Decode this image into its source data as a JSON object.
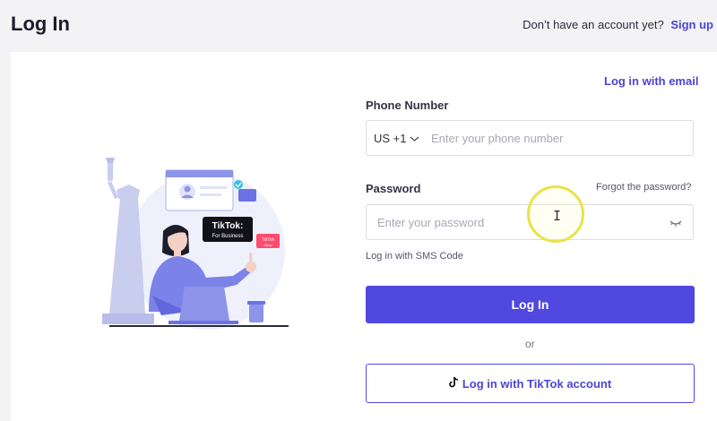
{
  "header": {
    "title": "Log In",
    "signup_prompt": "Don’t have an account yet?",
    "signup_link": "Sign up"
  },
  "form": {
    "email_link": "Log in with email",
    "phone_label": "Phone Number",
    "country_code": "US +1",
    "phone_placeholder": "Enter your phone number",
    "password_label": "Password",
    "forgot_link": "Forgot the password?",
    "password_placeholder": "Enter your password",
    "sms_link": "Log in with SMS Code",
    "login_button": "Log In",
    "or_text": "or",
    "tiktok_button": "Log in with TikTok account"
  },
  "illustration": {
    "badge_title": "TikTok:",
    "badge_subtitle": "For Business",
    "tag_title": "TikTok",
    "tag_subtitle": "Shop"
  },
  "colors": {
    "accent": "#5148e0",
    "link": "#4b45d4",
    "background": "#f3f3f6"
  },
  "icons": [
    "chevron-down-icon",
    "eye-closed-icon",
    "tiktok-icon",
    "text-cursor-icon"
  ]
}
